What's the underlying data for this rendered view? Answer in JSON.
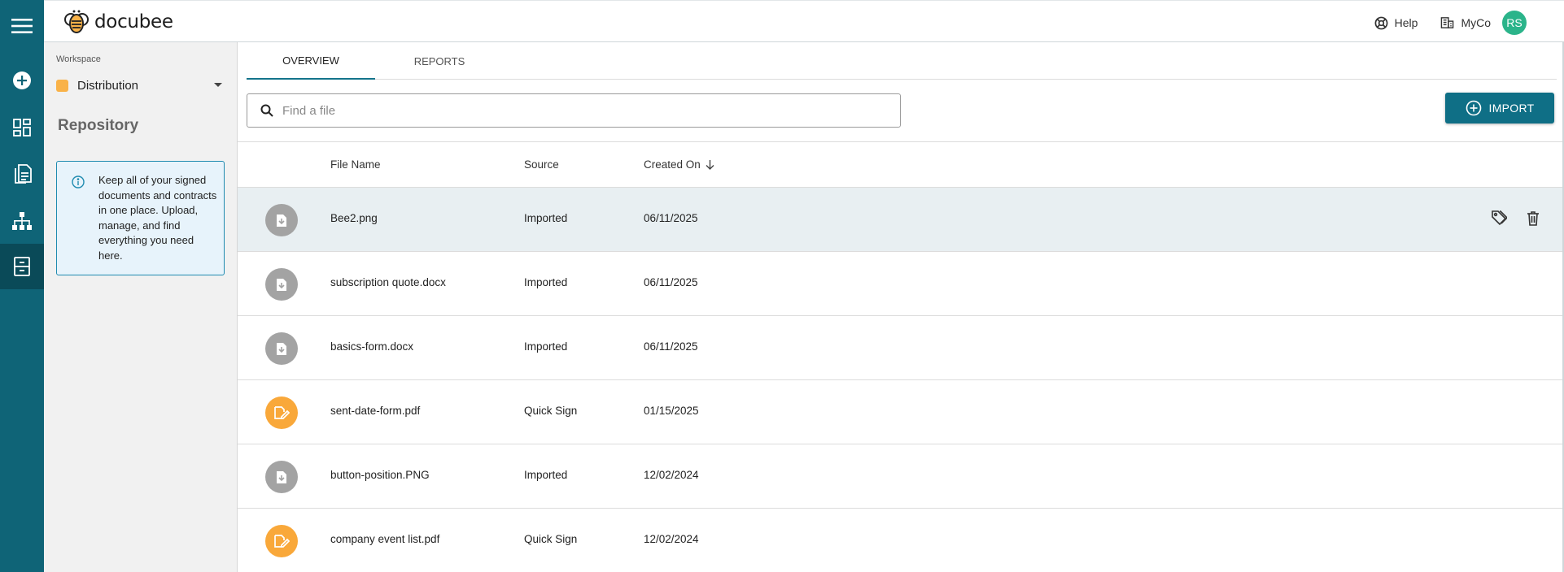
{
  "app": {
    "logo_text": "docubee",
    "brand_color": "#0f6477"
  },
  "rail": {
    "items": [
      {
        "name": "menu-icon"
      },
      {
        "name": "add-circle-icon"
      },
      {
        "name": "dashboard-icon"
      },
      {
        "name": "documents-icon"
      },
      {
        "name": "workflow-icon"
      },
      {
        "name": "repository-icon",
        "active": true
      }
    ]
  },
  "header": {
    "help_label": "Help",
    "org_label": "MyCo",
    "avatar_initials": "RS"
  },
  "sidebar": {
    "workspace_label": "Workspace",
    "workspace_name": "Distribution",
    "workspace_color": "#f9b248",
    "section_title": "Repository",
    "info_text": "Keep all of your signed documents and contracts in one place. Upload, manage, and find everything you need here."
  },
  "tabs": [
    {
      "label": "OVERVIEW",
      "active": true
    },
    {
      "label": "REPORTS",
      "active": false
    }
  ],
  "search": {
    "placeholder": "Find a file",
    "value": ""
  },
  "import_button": {
    "label": "IMPORT"
  },
  "table": {
    "columns": {
      "file_name": "File Name",
      "source": "Source",
      "created_on": "Created On",
      "sort_indicator": "arrow-down-icon"
    },
    "rows": [
      {
        "name": "Bee2.png",
        "source": "Imported",
        "created": "06/11/2025",
        "icon": "imported-file-icon",
        "selected": true
      },
      {
        "name": "subscription quote.docx",
        "source": "Imported",
        "created": "06/11/2025",
        "icon": "imported-file-icon"
      },
      {
        "name": "basics-form.docx",
        "source": "Imported",
        "created": "06/11/2025",
        "icon": "imported-file-icon"
      },
      {
        "name": "sent-date-form.pdf",
        "source": "Quick Sign",
        "created": "01/15/2025",
        "icon": "quick-sign-icon"
      },
      {
        "name": "button-position.PNG",
        "source": "Imported",
        "created": "12/02/2024",
        "icon": "imported-file-icon"
      },
      {
        "name": "company event list.pdf",
        "source": "Quick Sign",
        "created": "12/02/2024",
        "icon": "quick-sign-icon"
      }
    ],
    "row_actions": [
      "tag-icon",
      "trash-icon"
    ]
  },
  "colors": {
    "imported_icon": "#a3a3a3",
    "quick_sign_icon": "#f9a83a",
    "selected_row": "#e8eff2",
    "accent": "#0f6f86",
    "avatar": "#2bb48a"
  }
}
